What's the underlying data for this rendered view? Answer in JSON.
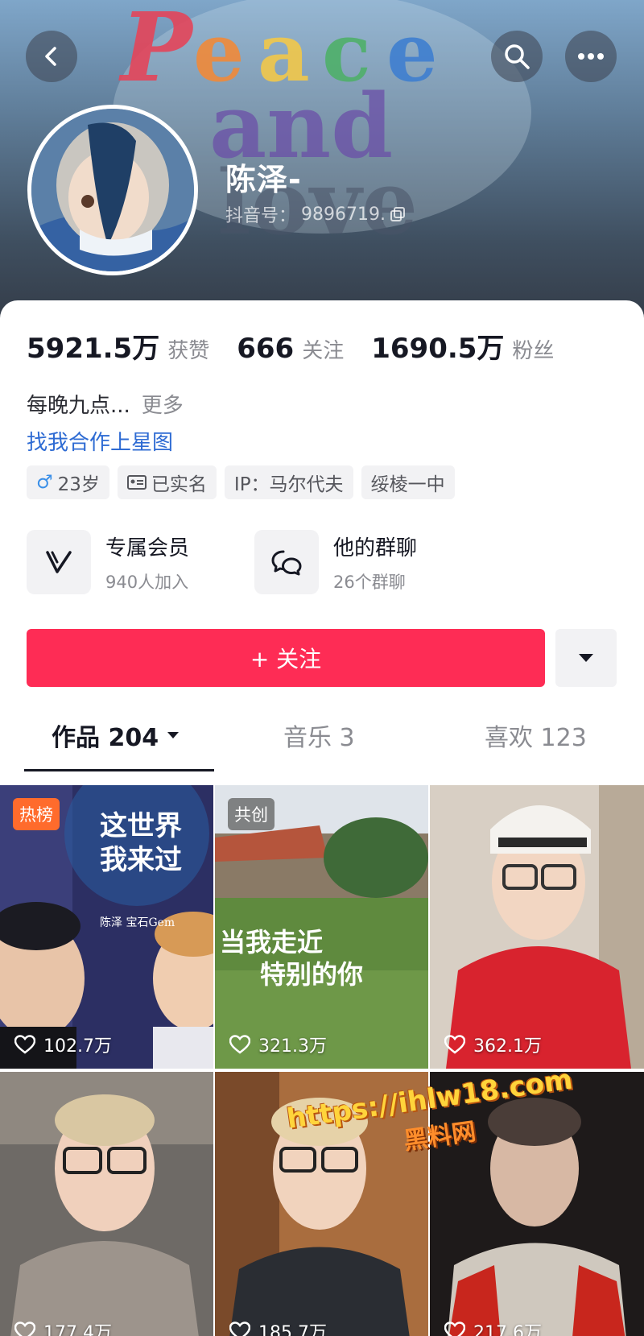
{
  "header": {
    "back_icon": "chevron-left-icon",
    "search_icon": "search-icon",
    "more_icon": "ellipsis-icon",
    "art_text": "Peace and Love",
    "nickname": "陈泽-",
    "id_label": "抖音号：",
    "id_value": "9896719.",
    "copy_icon": "copy-icon"
  },
  "stats": [
    {
      "value": "5921.5万",
      "label": "获赞"
    },
    {
      "value": "666",
      "label": "关注"
    },
    {
      "value": "1690.5万",
      "label": "粉丝"
    }
  ],
  "bio": {
    "text": "每晚九点...",
    "more": "更多"
  },
  "link": "找我合作上星图",
  "tags": {
    "age": "23岁",
    "age_icon": "male-icon",
    "verified": "已实名",
    "verified_icon": "id-card-icon",
    "ip": "IP：马尔代夫",
    "school": "绥棱一中"
  },
  "features": [
    {
      "title": "专属会员",
      "subtitle": "940人加入",
      "icon": "vip-icon"
    },
    {
      "title": "他的群聊",
      "subtitle": "26个群聊",
      "icon": "chat-bubbles-icon"
    }
  ],
  "actions": {
    "follow": "+ 关注",
    "dropdown_icon": "caret-down-icon"
  },
  "tabs": [
    {
      "label": "作品 204",
      "active": true
    },
    {
      "label": "音乐 3",
      "active": false
    },
    {
      "label": "喜欢 123",
      "active": false
    }
  ],
  "videos": [
    {
      "badge": "热榜",
      "likes": "102.7万",
      "title_lines": [
        "这世界",
        "我来过"
      ],
      "credit": "陈泽 宝石Gem"
    },
    {
      "badge": "共创",
      "likes": "321.3万",
      "title_lines": [
        "当我走近",
        "特别的你"
      ]
    },
    {
      "badge": "",
      "likes": "362.1万"
    },
    {
      "badge": "",
      "likes": "177.4万"
    },
    {
      "badge": "",
      "likes": "185.7万"
    },
    {
      "badge": "",
      "likes": "217.6万"
    }
  ],
  "watermark": {
    "url": "https://ihlw18.com",
    "name": "黑料网"
  },
  "colors": {
    "accent": "#fe2c55",
    "link": "#2e6bd3",
    "hot_badge": "#ff6b2c"
  }
}
